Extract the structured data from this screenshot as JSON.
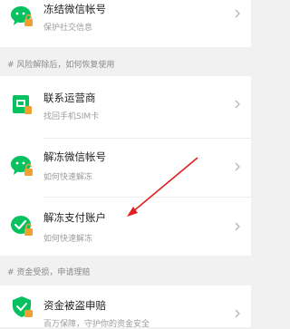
{
  "top_item": {
    "title": "冻结微信帐号",
    "subtitle": "保护社交信息"
  },
  "section1": {
    "header": "# 风险解除后，如何恢复使用",
    "items": [
      {
        "title": "联系运营商",
        "subtitle": "找回手机SIM卡",
        "icon": "sim-card-icon"
      },
      {
        "title": "解冻微信帐号",
        "subtitle": "如何快速解冻",
        "icon": "wechat-unlock-icon"
      },
      {
        "title": "解冻支付账户",
        "subtitle": "如何快速解冻",
        "icon": "pay-unlock-icon"
      }
    ]
  },
  "section2": {
    "header": "# 资金受损，申请理赔",
    "items": [
      {
        "title": "资金被盗申赔",
        "subtitle": "百万保障，守护你的资金安全",
        "icon": "shield-icon"
      }
    ]
  },
  "colors": {
    "accent_green": "#07c160",
    "arrow_red": "#e02020",
    "lock_orange": "#f0a030"
  }
}
